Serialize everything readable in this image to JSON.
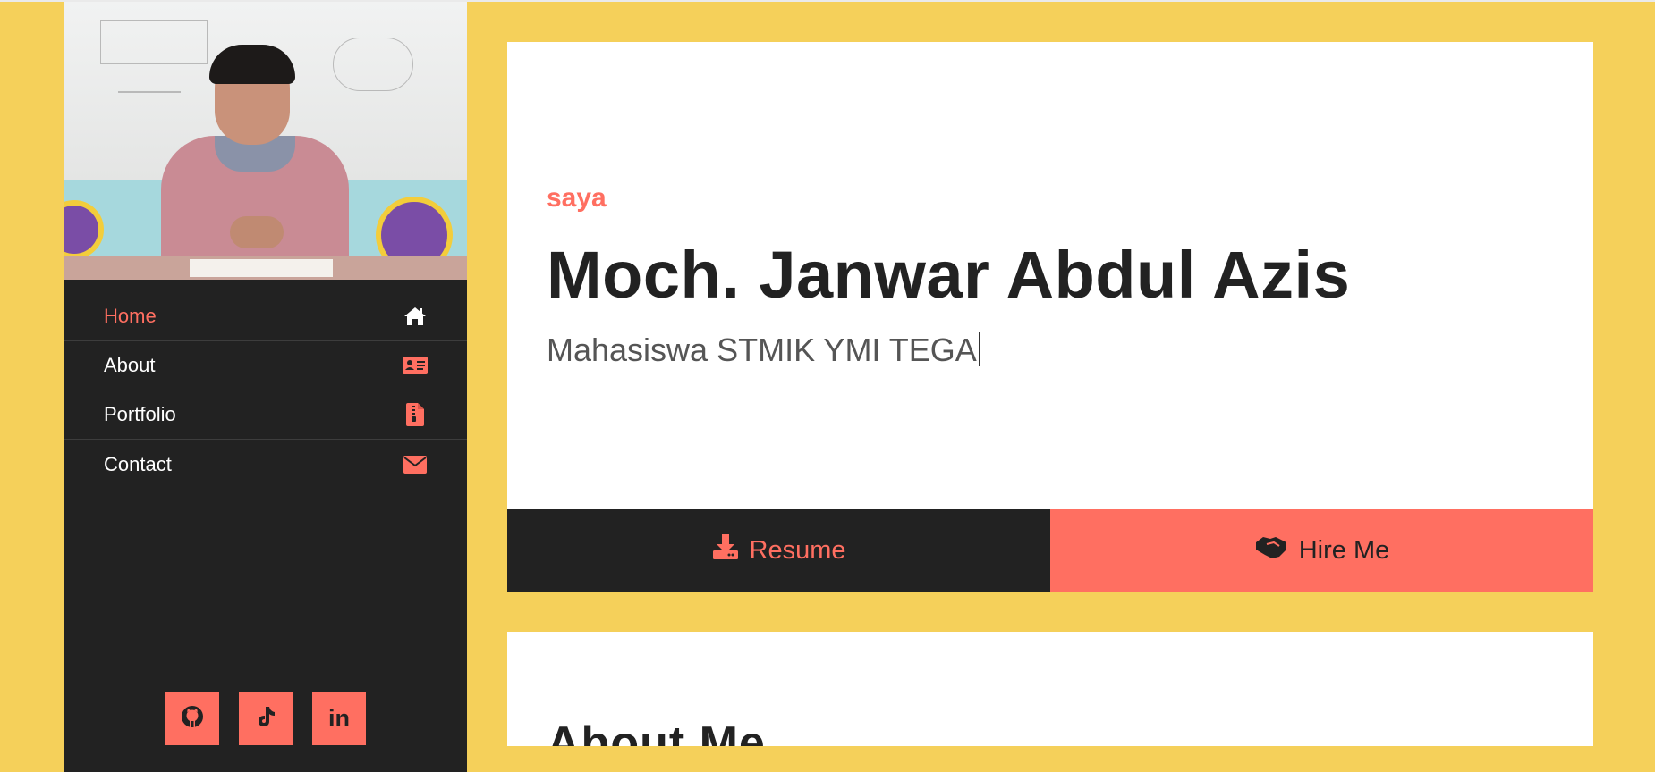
{
  "colors": {
    "page_background": "#f5d05a",
    "sidebar_background": "#222222",
    "accent": "#ff6f61",
    "text_dark": "#222222",
    "text_muted": "#555555"
  },
  "sidebar": {
    "nav": [
      {
        "label": "Home",
        "icon": "home-icon",
        "active": true
      },
      {
        "label": "About",
        "icon": "id-card-icon",
        "active": false
      },
      {
        "label": "Portfolio",
        "icon": "file-zipper-icon",
        "active": false
      },
      {
        "label": "Contact",
        "icon": "envelope-icon",
        "active": false
      }
    ],
    "socials": [
      {
        "icon": "github-icon"
      },
      {
        "icon": "tiktok-icon"
      },
      {
        "icon": "linkedin-icon",
        "label": "in"
      }
    ]
  },
  "hero": {
    "subtitle": "saya",
    "name": "Moch. Janwar Abdul Azis",
    "role": "Mahasiswa STMIK YMI TEGA"
  },
  "buttons": {
    "resume_label": "Resume",
    "hire_label": "Hire Me"
  },
  "about": {
    "title": "About Me"
  }
}
